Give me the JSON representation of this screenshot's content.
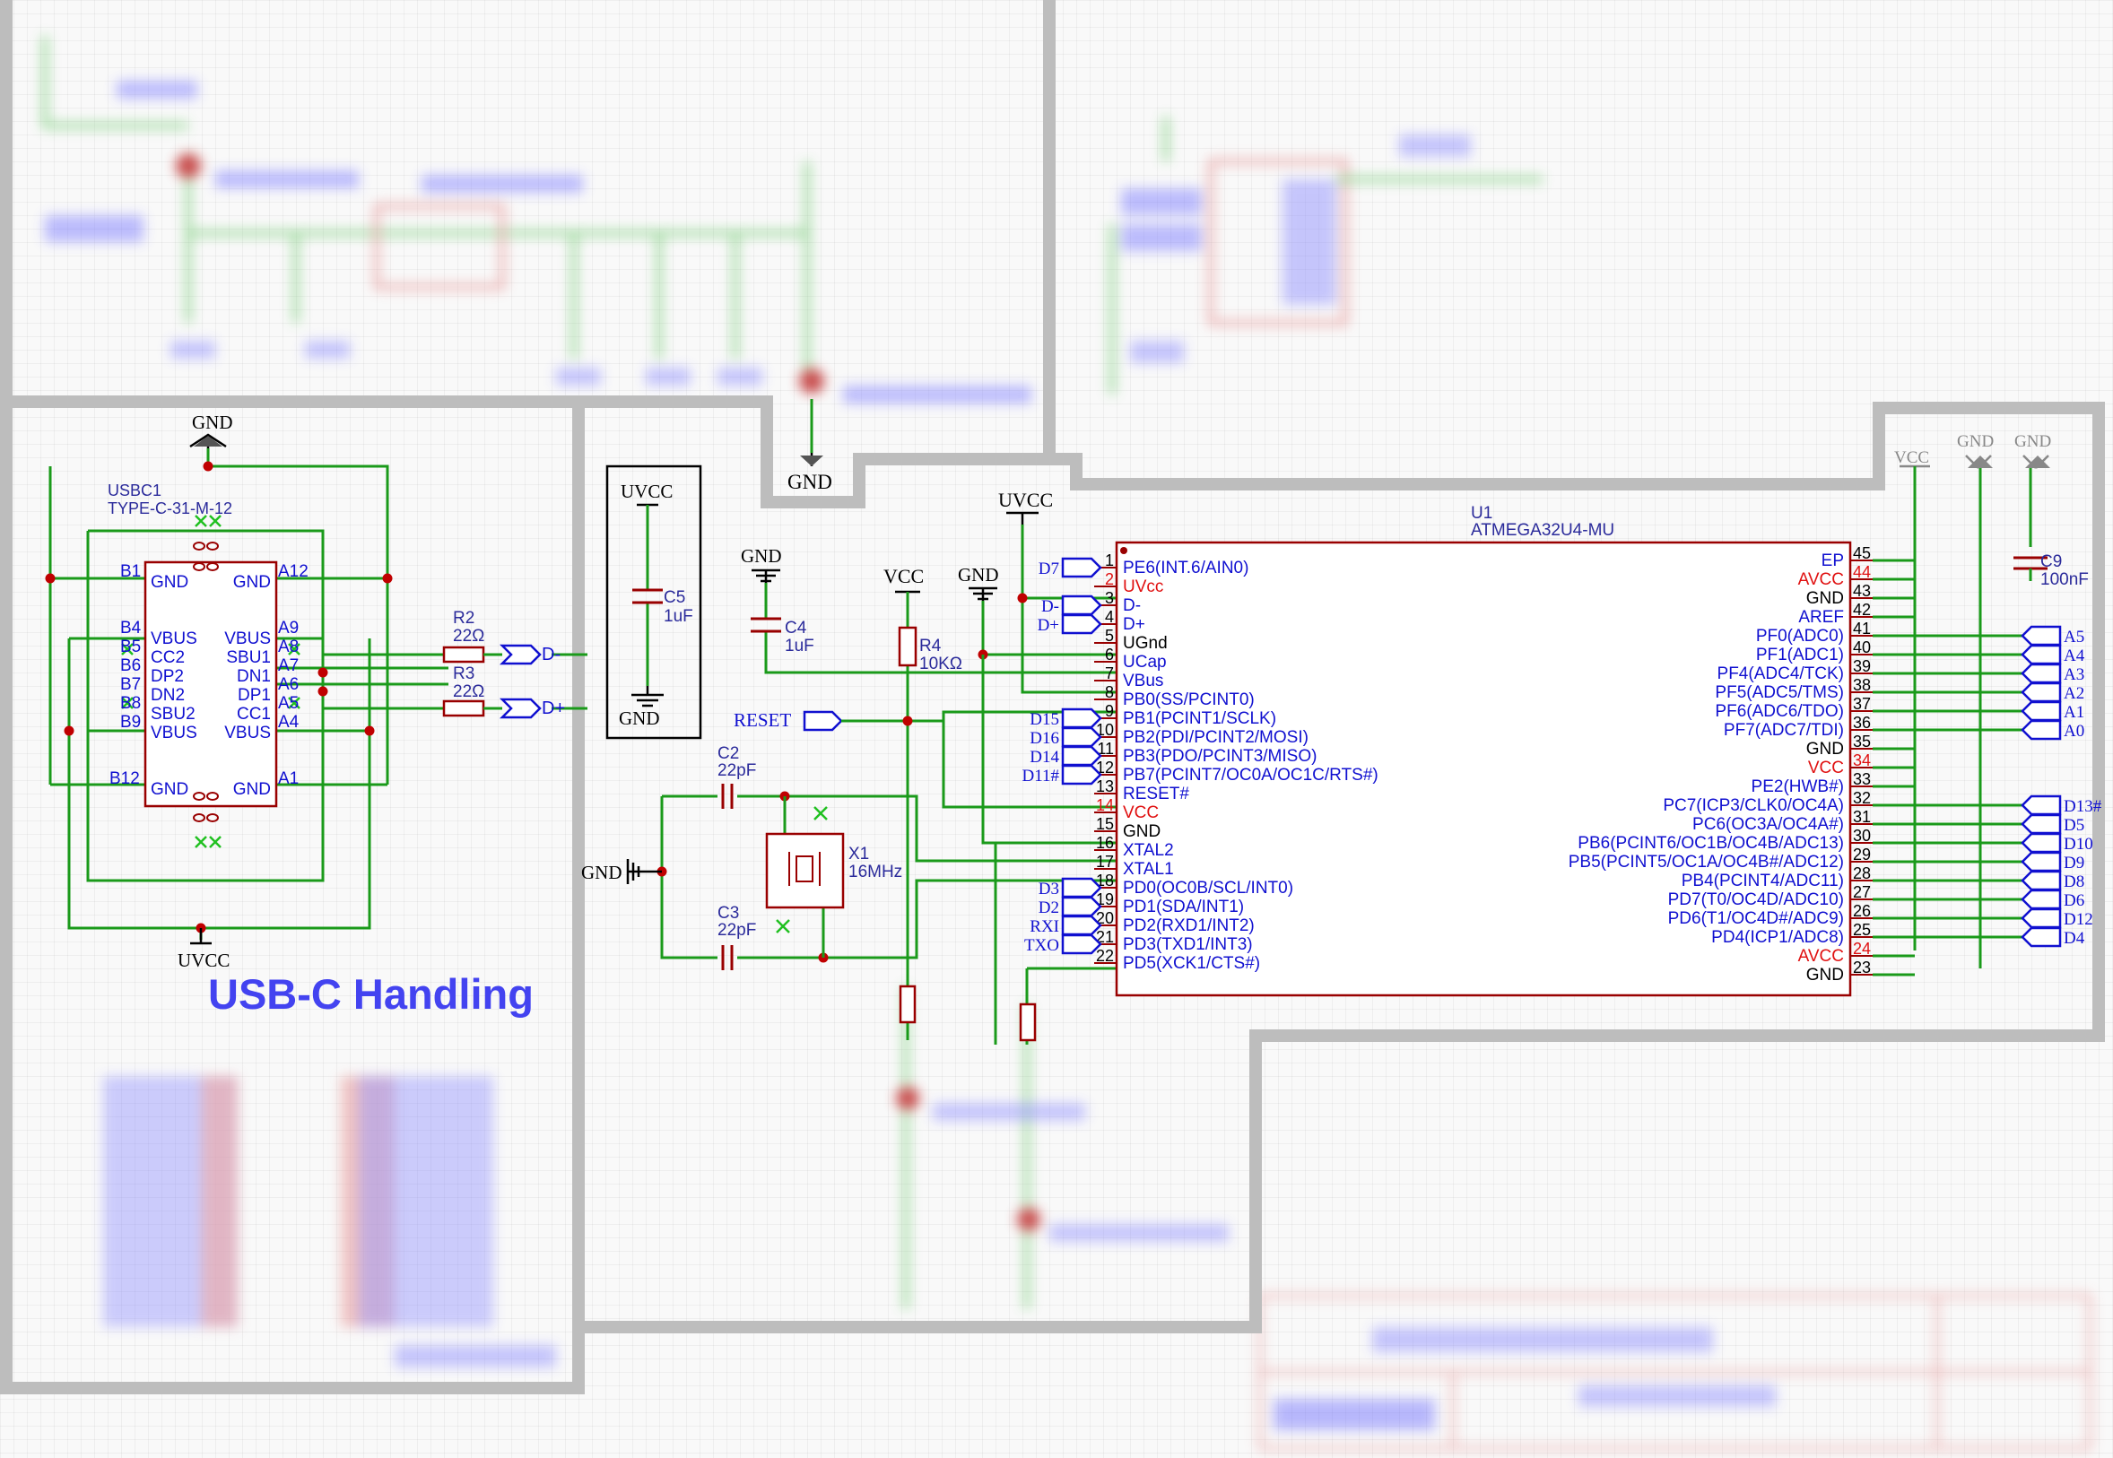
{
  "usbc": {
    "section_title": "USB-C Handling",
    "gnd_top": "GND",
    "uvcc_bottom": "UVCC",
    "designator": "USBC1",
    "part": "TYPE-C-31-M-12",
    "left_pins": [
      "B1",
      "B4",
      "B5",
      "B6",
      "B7",
      "B8",
      "B9",
      "B12"
    ],
    "left_inner": [
      "GND",
      "VBUS",
      "CC2",
      "DP2",
      "DN2",
      "SBU2",
      "VBUS",
      "GND"
    ],
    "right_pins": [
      "A12",
      "A9",
      "A8",
      "A7",
      "A6",
      "A5",
      "A4",
      "A1"
    ],
    "right_inner": [
      "GND",
      "VBUS",
      "SBU1",
      "DN1",
      "DP1",
      "CC1",
      "VBUS",
      "GND"
    ],
    "r2_name": "R2",
    "r2_value": "22Ω",
    "r3_name": "R3",
    "r3_value": "22Ω",
    "dminus": "D-",
    "dplus": "D+"
  },
  "c5box": {
    "uvcc": "UVCC",
    "name": "C5",
    "value": "1uF",
    "gnd": "GND"
  },
  "power": {
    "gnd_c4": "GND",
    "c4_name": "C4",
    "c4_value": "1uF",
    "vcc_r4": "VCC",
    "r4_name": "R4",
    "r4_value": "10KΩ",
    "gnd_mid": "GND",
    "uvcc_top": "UVCC",
    "gnd_notch": "GND",
    "reset": "RESET"
  },
  "crystal": {
    "c2_name": "C2",
    "c2_value": "22pF",
    "c3_name": "C3",
    "c3_value": "22pF",
    "x1_name": "X1",
    "x1_value": "16MHz",
    "gnd": "GND"
  },
  "mcu": {
    "designator": "U1",
    "part": "ATMEGA32U4-MU",
    "left_pins": [
      {
        "num": "1",
        "label": "PE6(INT.6/AIN0)",
        "port": "D7",
        "red": false
      },
      {
        "num": "2",
        "label": "UVcc",
        "port": "",
        "red": true
      },
      {
        "num": "3",
        "label": "D-",
        "port": "D-",
        "red": false
      },
      {
        "num": "4",
        "label": "D+",
        "port": "D+",
        "red": false
      },
      {
        "num": "5",
        "label": "UGnd",
        "port": "",
        "red": false
      },
      {
        "num": "6",
        "label": "UCap",
        "port": "",
        "red": false
      },
      {
        "num": "7",
        "label": "VBus",
        "port": "",
        "red": false
      },
      {
        "num": "8",
        "label": "PB0(SS/PCINT0)",
        "port": "",
        "red": false
      },
      {
        "num": "9",
        "label": "PB1(PCINT1/SCLK)",
        "port": "D15",
        "red": false
      },
      {
        "num": "10",
        "label": "PB2(PDI/PCINT2/MOSI)",
        "port": "D16",
        "red": false
      },
      {
        "num": "11",
        "label": "PB3(PDO/PCINT3/MISO)",
        "port": "D14",
        "red": false
      },
      {
        "num": "12",
        "label": "PB7(PCINT7/OC0A/OC1C/RTS#)",
        "port": "D11#",
        "red": false
      },
      {
        "num": "13",
        "label": "RESET#",
        "port": "",
        "red": false
      },
      {
        "num": "14",
        "label": "VCC",
        "port": "",
        "red": true
      },
      {
        "num": "15",
        "label": "GND",
        "port": "",
        "red": false
      },
      {
        "num": "16",
        "label": "XTAL2",
        "port": "",
        "red": false
      },
      {
        "num": "17",
        "label": "XTAL1",
        "port": "",
        "red": false
      },
      {
        "num": "18",
        "label": "PD0(OC0B/SCL/INT0)",
        "port": "D3",
        "red": false
      },
      {
        "num": "19",
        "label": "PD1(SDA/INT1)",
        "port": "D2",
        "red": false
      },
      {
        "num": "20",
        "label": "PD2(RXD1/INT2)",
        "port": "RXI",
        "red": false
      },
      {
        "num": "21",
        "label": "PD3(TXD1/INT3)",
        "port": "TXO",
        "red": false
      },
      {
        "num": "22",
        "label": "PD5(XCK1/CTS#)",
        "port": "",
        "red": false
      }
    ],
    "right_pins": [
      {
        "num": "45",
        "label": "EP",
        "port": "",
        "red": false
      },
      {
        "num": "44",
        "label": "AVCC",
        "port": "",
        "red": true
      },
      {
        "num": "43",
        "label": "GND",
        "port": "",
        "red": false
      },
      {
        "num": "42",
        "label": "AREF",
        "port": "",
        "red": false
      },
      {
        "num": "41",
        "label": "PF0(ADC0)",
        "port": "A5",
        "red": false
      },
      {
        "num": "40",
        "label": "PF1(ADC1)",
        "port": "A4",
        "red": false
      },
      {
        "num": "39",
        "label": "PF4(ADC4/TCK)",
        "port": "A3",
        "red": false
      },
      {
        "num": "38",
        "label": "PF5(ADC5/TMS)",
        "port": "A2",
        "red": false
      },
      {
        "num": "37",
        "label": "PF6(ADC6/TDO)",
        "port": "A1",
        "red": false
      },
      {
        "num": "36",
        "label": "PF7(ADC7/TDI)",
        "port": "A0",
        "red": false
      },
      {
        "num": "35",
        "label": "GND",
        "port": "",
        "red": false
      },
      {
        "num": "34",
        "label": "VCC",
        "port": "",
        "red": true
      },
      {
        "num": "33",
        "label": "PE2(HWB#)",
        "port": "",
        "red": false
      },
      {
        "num": "32",
        "label": "PC7(ICP3/CLK0/OC4A)",
        "port": "D13#",
        "red": false
      },
      {
        "num": "31",
        "label": "PC6(OC3A/OC4A#)",
        "port": "D5",
        "red": false
      },
      {
        "num": "30",
        "label": "PB6(PCINT6/OC1B/OC4B/ADC13)",
        "port": "D10",
        "red": false
      },
      {
        "num": "29",
        "label": "PB5(PCINT5/OC1A/OC4B#/ADC12)",
        "port": "D9",
        "red": false
      },
      {
        "num": "28",
        "label": "PB4(PCINT4/ADC11)",
        "port": "D8",
        "red": false
      },
      {
        "num": "27",
        "label": "PD7(T0/OC4D/ADC10)",
        "port": "D6",
        "red": false
      },
      {
        "num": "26",
        "label": "PD6(T1/OC4D#/ADC9)",
        "port": "D12",
        "red": false
      },
      {
        "num": "25",
        "label": "PD4(ICP1/ADC8)",
        "port": "D4",
        "red": false
      },
      {
        "num": "24",
        "label": "AVCC",
        "port": "",
        "red": true
      },
      {
        "num": "23",
        "label": "GND",
        "port": "",
        "red": false
      }
    ],
    "pin_num_colors": {
      "normal": "#000000",
      "red": "#e01010"
    }
  },
  "right_power": {
    "vcc": "VCC",
    "gnd1": "GND",
    "gnd2": "GND",
    "c9_name": "C9",
    "c9_value": "100nF"
  },
  "top_gnd": "GND",
  "colors": {
    "wire": "#1a9a1a",
    "symbol": "#990000",
    "label_blue": "#1010d0",
    "power_red": "#e01010",
    "sheet_border": "#bdbdbd"
  }
}
